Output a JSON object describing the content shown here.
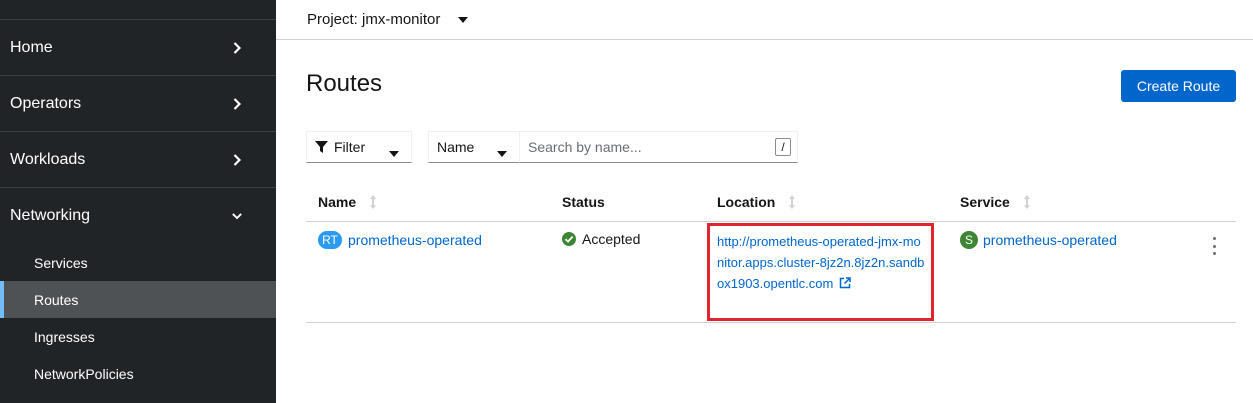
{
  "sidebar": {
    "sections": [
      {
        "label": "Home",
        "expanded": false
      },
      {
        "label": "Operators",
        "expanded": false
      },
      {
        "label": "Workloads",
        "expanded": false
      },
      {
        "label": "Networking",
        "expanded": true
      }
    ],
    "networking_items": [
      {
        "label": "Services",
        "active": false
      },
      {
        "label": "Routes",
        "active": true
      },
      {
        "label": "Ingresses",
        "active": false
      },
      {
        "label": "NetworkPolicies",
        "active": false
      }
    ]
  },
  "project": {
    "label": "Project: jmx-monitor"
  },
  "page": {
    "title": "Routes",
    "create_button": "Create Route"
  },
  "toolbar": {
    "filter_label": "Filter",
    "name_select": "Name",
    "search_placeholder": "Search by name...",
    "search_value": "",
    "shortcut_key": "/"
  },
  "table": {
    "columns": [
      "Name",
      "Status",
      "Location",
      "Service"
    ],
    "rows": [
      {
        "name_badge": "RT",
        "name": "prometheus-operated",
        "status": "Accepted",
        "location": "http://prometheus-operated-jmx-monitor.apps.cluster-8jz2n.8jz2n.sandbox1903.opentlc.com",
        "service_badge": "S",
        "service": "prometheus-operated"
      }
    ]
  },
  "colors": {
    "accent": "#0066cc",
    "sidebar_bg": "#212427",
    "success": "#3e8635",
    "route_badge": "#2b9af3",
    "highlight": "#e0232e"
  }
}
